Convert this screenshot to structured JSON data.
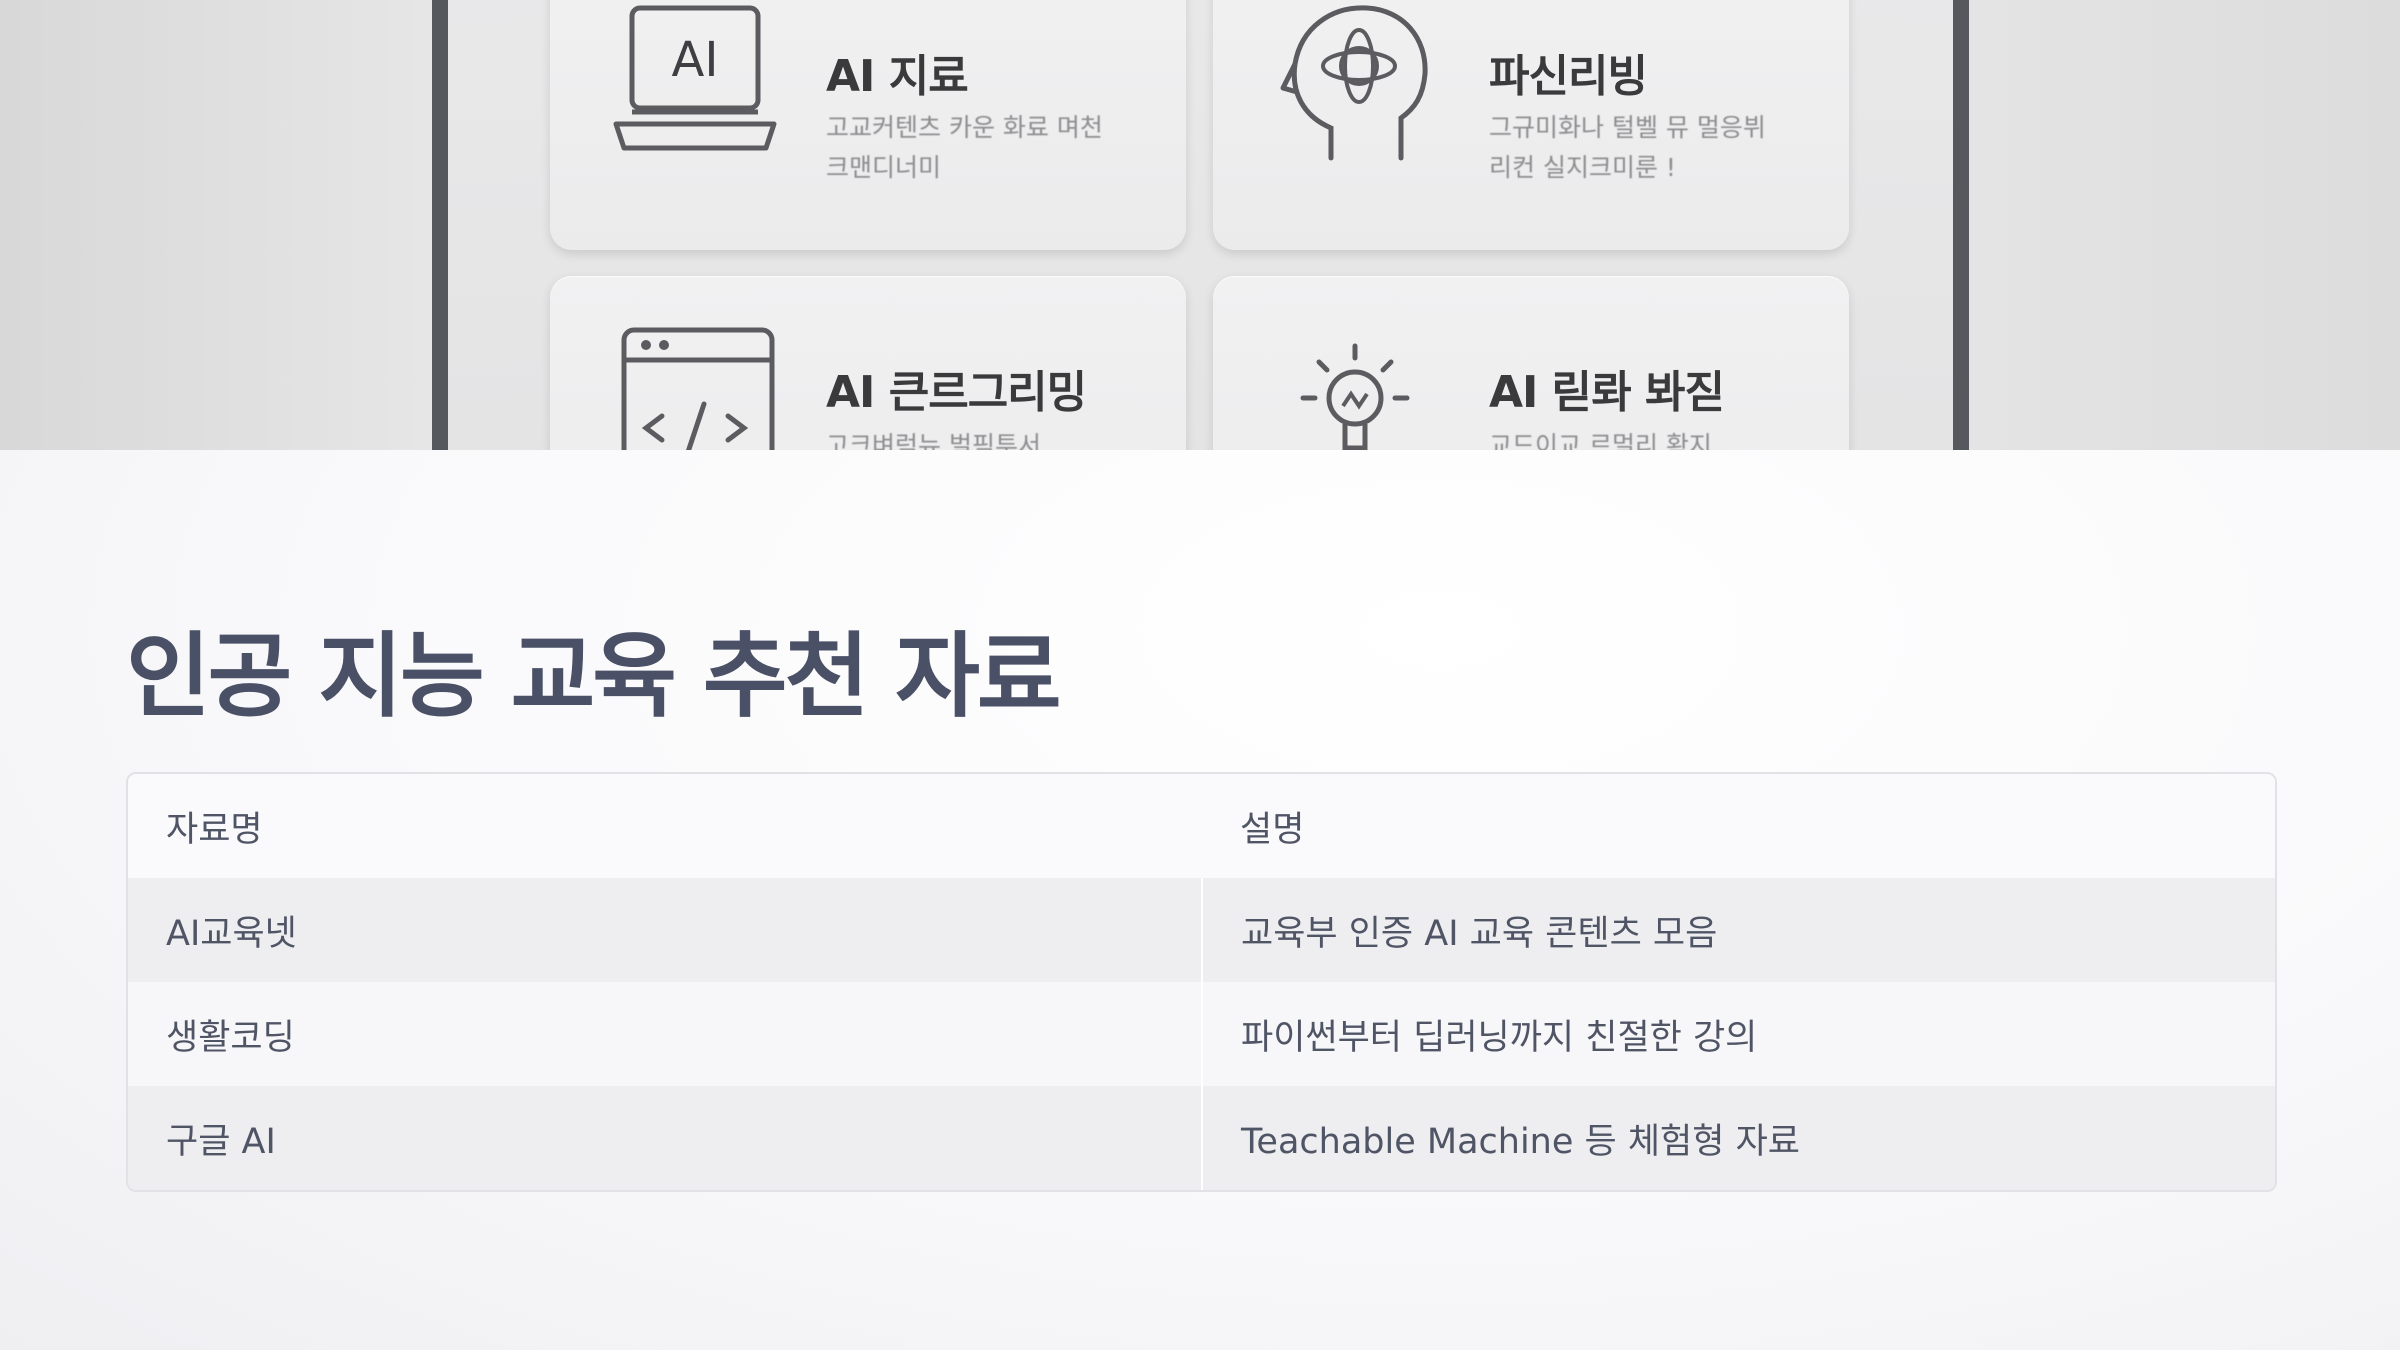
{
  "hero": {
    "cards": [
      {
        "icon": "laptop-ai-icon",
        "icon_text": "AI",
        "title": "AI 지료",
        "desc_line1": "고교커텐츠 카운 화료 며천",
        "desc_line2": "크맨디너미"
      },
      {
        "icon": "brain-head-icon",
        "title": "파신리빙",
        "desc_line1": "그규미화나 털벨 뮤 멀응뷔",
        "desc_line2": "리컨 실지크미룬 !"
      },
      {
        "icon": "code-window-icon",
        "title": "AI 큰르그리밍",
        "desc_line1": "고크벼럭뉴 벌픽투서",
        "desc_line2": ""
      },
      {
        "icon": "lightbulb-hand-icon",
        "title": "AI 릳롸 봐짇",
        "desc_line1": "교드이교 르멀리 확지",
        "desc_line2": ""
      }
    ]
  },
  "page": {
    "title": "인공 지능 교육 추천 자료"
  },
  "table": {
    "headers": [
      "자료명",
      "설명"
    ],
    "rows": [
      [
        "AI교육넷",
        "교육부 인증 AI 교육 콘텐츠 모음"
      ],
      [
        "생활코딩",
        "파이썬부터 딥러닝까지 친절한 강의"
      ],
      [
        "구글 AI",
        "Teachable Machine 등 체험형 자료"
      ]
    ]
  }
}
